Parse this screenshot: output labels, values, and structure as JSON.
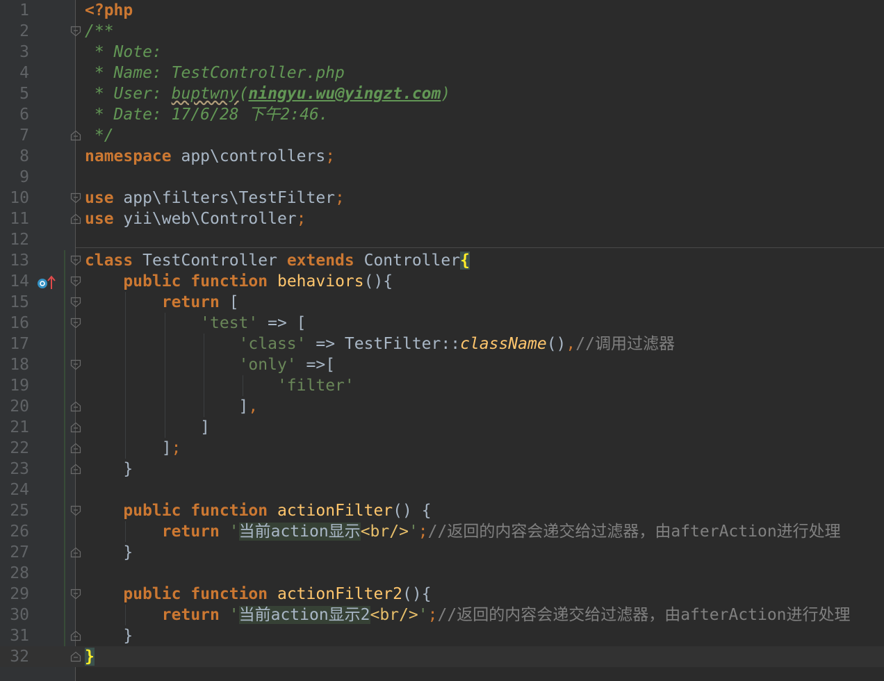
{
  "editor": {
    "file": "TestController.php",
    "lines": [
      {
        "n": "1",
        "fold": "",
        "tokens": [
          [
            "kw",
            "<?php"
          ]
        ]
      },
      {
        "n": "2",
        "fold": "open",
        "tokens": [
          [
            "cm",
            "/**"
          ]
        ]
      },
      {
        "n": "3",
        "fold": "",
        "tokens": [
          [
            "cm",
            " * Note:"
          ]
        ]
      },
      {
        "n": "4",
        "fold": "",
        "tokens": [
          [
            "cm",
            " * Name: TestController.php"
          ]
        ]
      },
      {
        "n": "5",
        "fold": "",
        "tokens": [
          [
            "cm",
            " * User: "
          ],
          [
            "cmw",
            "buptwny"
          ],
          [
            "cm",
            "("
          ],
          [
            "link",
            "ningyu.wu@yingzt.com"
          ],
          [
            "cm",
            ")"
          ]
        ]
      },
      {
        "n": "6",
        "fold": "",
        "tokens": [
          [
            "cm",
            " * Date: 17/6/28 下午2:46."
          ]
        ]
      },
      {
        "n": "7",
        "fold": "close",
        "tokens": [
          [
            "cm",
            " */"
          ]
        ]
      },
      {
        "n": "8",
        "fold": "",
        "tokens": [
          [
            "kw",
            "namespace"
          ],
          [
            "txt",
            " app\\controllers"
          ],
          [
            "punc",
            ";"
          ]
        ]
      },
      {
        "n": "9",
        "fold": "",
        "tokens": []
      },
      {
        "n": "10",
        "fold": "open",
        "tokens": [
          [
            "kw",
            "use"
          ],
          [
            "txt",
            " app\\filters\\TestFilter"
          ],
          [
            "punc",
            ";"
          ]
        ]
      },
      {
        "n": "11",
        "fold": "close",
        "tokens": [
          [
            "kw",
            "use"
          ],
          [
            "txt",
            " yii\\web\\Controller"
          ],
          [
            "punc",
            ";"
          ]
        ]
      },
      {
        "n": "12",
        "fold": "",
        "tokens": []
      },
      {
        "n": "13",
        "fold": "open",
        "tokens": [
          [
            "kw",
            "class"
          ],
          [
            "txt",
            " TestController "
          ],
          [
            "kw",
            "extends"
          ],
          [
            "txt",
            " Controller"
          ],
          [
            "brace",
            "{"
          ]
        ]
      },
      {
        "n": "14",
        "fold": "open",
        "override": true,
        "tokens": [
          [
            "txt",
            "    "
          ],
          [
            "kw",
            "public"
          ],
          [
            "txt",
            " "
          ],
          [
            "kw",
            "function"
          ],
          [
            "txt",
            " "
          ],
          [
            "fn",
            "behaviors"
          ],
          [
            "txt",
            "(){"
          ]
        ]
      },
      {
        "n": "15",
        "fold": "open",
        "tokens": [
          [
            "txt",
            "        "
          ],
          [
            "kw",
            "return"
          ],
          [
            "txt",
            " ["
          ]
        ]
      },
      {
        "n": "16",
        "fold": "open",
        "tokens": [
          [
            "txt",
            "            "
          ],
          [
            "str",
            "'test'"
          ],
          [
            "txt",
            " => ["
          ]
        ]
      },
      {
        "n": "17",
        "fold": "",
        "tokens": [
          [
            "txt",
            "                "
          ],
          [
            "str",
            "'class'"
          ],
          [
            "txt",
            " => TestFilter::"
          ],
          [
            "sfn",
            "className"
          ],
          [
            "txt",
            "()"
          ],
          [
            "punc",
            ","
          ],
          [
            "lc",
            "//调用过滤器"
          ]
        ]
      },
      {
        "n": "18",
        "fold": "open",
        "tokens": [
          [
            "txt",
            "                "
          ],
          [
            "str",
            "'only'"
          ],
          [
            "txt",
            " =>["
          ]
        ]
      },
      {
        "n": "19",
        "fold": "",
        "tokens": [
          [
            "txt",
            "                    "
          ],
          [
            "str",
            "'filter'"
          ]
        ]
      },
      {
        "n": "20",
        "fold": "close",
        "tokens": [
          [
            "txt",
            "                ]"
          ],
          [
            "punc",
            ","
          ]
        ]
      },
      {
        "n": "21",
        "fold": "close",
        "tokens": [
          [
            "txt",
            "            ]"
          ]
        ]
      },
      {
        "n": "22",
        "fold": "close",
        "tokens": [
          [
            "txt",
            "        ]"
          ],
          [
            "punc",
            ";"
          ]
        ]
      },
      {
        "n": "23",
        "fold": "close",
        "tokens": [
          [
            "txt",
            "    }"
          ]
        ]
      },
      {
        "n": "24",
        "fold": "",
        "tokens": []
      },
      {
        "n": "25",
        "fold": "open",
        "tokens": [
          [
            "txt",
            "    "
          ],
          [
            "kw",
            "public"
          ],
          [
            "txt",
            " "
          ],
          [
            "kw",
            "function"
          ],
          [
            "txt",
            " "
          ],
          [
            "fn",
            "actionFilter"
          ],
          [
            "txt",
            "() {"
          ]
        ]
      },
      {
        "n": "26",
        "fold": "",
        "tokens": [
          [
            "txt",
            "        "
          ],
          [
            "kw",
            "return"
          ],
          [
            "txt",
            " "
          ],
          [
            "str",
            "'"
          ],
          [
            "strhl",
            "当前action显示"
          ],
          [
            "tag",
            "<br/>"
          ],
          [
            "str",
            "'"
          ],
          [
            "punc",
            ";"
          ],
          [
            "lc",
            "//返回的内容会递交给过滤器，由afterAction进行处理"
          ]
        ]
      },
      {
        "n": "27",
        "fold": "close",
        "tokens": [
          [
            "txt",
            "    }"
          ]
        ]
      },
      {
        "n": "28",
        "fold": "",
        "tokens": []
      },
      {
        "n": "29",
        "fold": "open",
        "tokens": [
          [
            "txt",
            "    "
          ],
          [
            "kw",
            "public"
          ],
          [
            "txt",
            " "
          ],
          [
            "kw",
            "function"
          ],
          [
            "txt",
            " "
          ],
          [
            "fn",
            "actionFilter2"
          ],
          [
            "txt",
            "(){"
          ]
        ]
      },
      {
        "n": "30",
        "fold": "",
        "tokens": [
          [
            "txt",
            "        "
          ],
          [
            "kw",
            "return"
          ],
          [
            "txt",
            " "
          ],
          [
            "str",
            "'"
          ],
          [
            "strhl",
            "当前action显示2"
          ],
          [
            "tag",
            "<br/>"
          ],
          [
            "str",
            "'"
          ],
          [
            "punc",
            ";"
          ],
          [
            "lc",
            "//返回的内容会递交给过滤器，由afterAction进行处理"
          ]
        ]
      },
      {
        "n": "31",
        "fold": "close",
        "tokens": [
          [
            "txt",
            "    }"
          ]
        ]
      },
      {
        "n": "32",
        "fold": "close",
        "caret": true,
        "tokens": [
          [
            "brace",
            "}"
          ]
        ]
      }
    ]
  },
  "colors": {
    "background": "#2b2b2b",
    "gutter": "#313335",
    "keyword": "#cc7832",
    "comment": "#629755",
    "string": "#6a8759",
    "function": "#ffc66d",
    "text": "#a9b7c6",
    "line_comment": "#808080",
    "tag": "#e8bf6a",
    "line_number": "#606366"
  },
  "icons": {
    "fold_open": "fold-open-icon",
    "fold_close": "fold-close-icon",
    "override": "method-override-icon"
  }
}
